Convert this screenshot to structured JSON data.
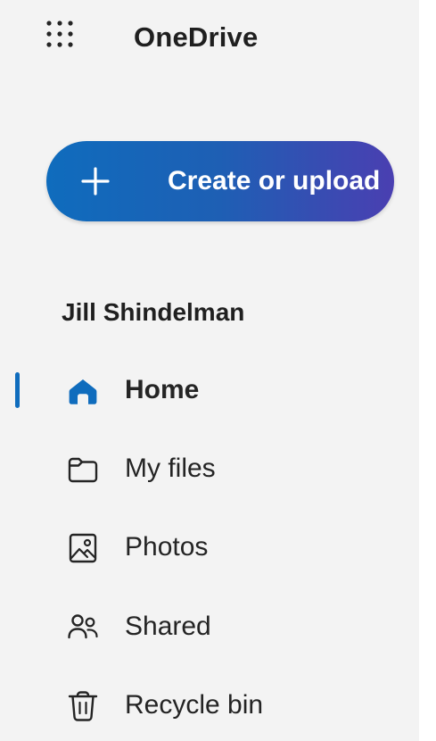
{
  "app": {
    "title": "OneDrive"
  },
  "create_button": {
    "label": "Create or upload"
  },
  "account": {
    "name": "Jill Shindelman"
  },
  "nav": {
    "items": [
      {
        "label": "Home",
        "icon": "home-icon",
        "active": true
      },
      {
        "label": "My files",
        "icon": "folder-icon",
        "active": false
      },
      {
        "label": "Photos",
        "icon": "image-icon",
        "active": false
      },
      {
        "label": "Shared",
        "icon": "people-icon",
        "active": false
      },
      {
        "label": "Recycle bin",
        "icon": "trash-icon",
        "active": false
      }
    ]
  },
  "colors": {
    "sidebar_bg": "#f3f3f3",
    "accent": "#0f6cbd",
    "button_gradient_end": "#4a3fb1",
    "text": "#242424"
  }
}
